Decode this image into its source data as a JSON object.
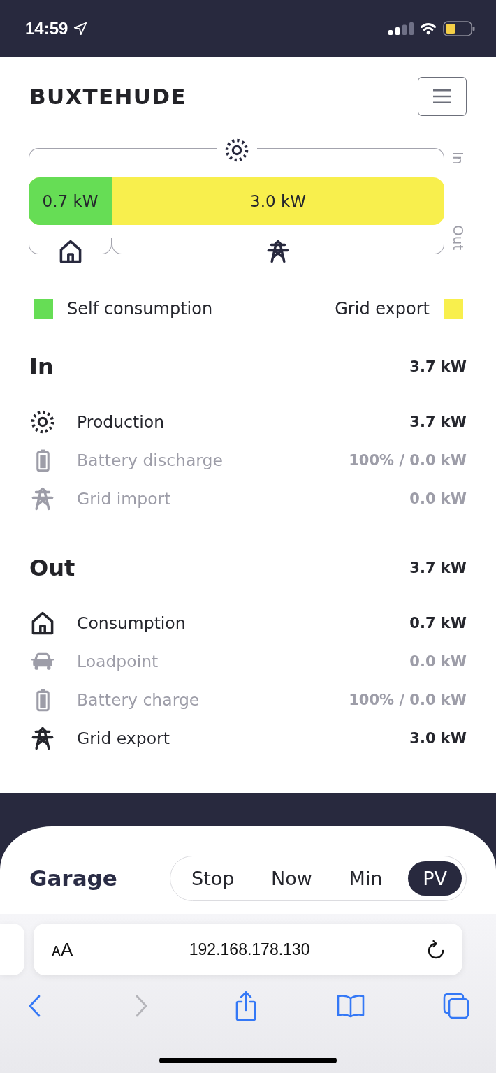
{
  "status_bar": {
    "time": "14:59"
  },
  "header": {
    "title": "BUXTEHUDE"
  },
  "flow": {
    "in_label": "In",
    "out_label": "Out",
    "level": 0.2,
    "segments": [
      {
        "kind": "home",
        "value": "0.7 kW",
        "color": "#66dd55"
      },
      {
        "kind": "grid",
        "value": "3.0 kW",
        "color": "#f8ef4d"
      }
    ]
  },
  "legend": [
    {
      "label": "Self consumption",
      "color": "#66dd55"
    },
    {
      "label": "Grid export",
      "color": "#f8ef4d"
    }
  ],
  "sections": [
    {
      "title": "In",
      "total": "3.7 kW",
      "rows": [
        {
          "kind": "pv",
          "label": "Production",
          "value": "3.7 kW",
          "active": true
        },
        {
          "kind": "battery",
          "label": "Battery discharge",
          "value": "100% / 0.0 kW",
          "active": false
        },
        {
          "kind": "grid",
          "label": "Grid import",
          "value": "0.0 kW",
          "active": false
        }
      ]
    },
    {
      "title": "Out",
      "total": "3.7 kW",
      "rows": [
        {
          "kind": "home",
          "label": "Consumption",
          "value": "0.7 kW",
          "active": true
        },
        {
          "kind": "vehicle",
          "label": "Loadpoint",
          "value": "0.0 kW",
          "active": false
        },
        {
          "kind": "battery",
          "label": "Battery charge",
          "value": "100% / 0.0 kW",
          "active": false
        },
        {
          "kind": "grid",
          "label": "Grid export",
          "value": "3.0 kW",
          "active": true
        }
      ]
    }
  ],
  "loadpoint": {
    "title": "Garage",
    "modes": [
      {
        "label": "Stop",
        "selected": false
      },
      {
        "label": "Now",
        "selected": false
      },
      {
        "label": "Min",
        "selected": false
      },
      {
        "label": "PV",
        "selected": true
      }
    ]
  },
  "browser": {
    "text_size_label": "ᴀA",
    "url": "192.168.178.130",
    "toolbar": [
      {
        "kind": "back",
        "disabled": false
      },
      {
        "kind": "forward",
        "disabled": true
      },
      {
        "kind": "share",
        "disabled": false
      },
      {
        "kind": "bookmarks",
        "disabled": false
      },
      {
        "kind": "tabs",
        "disabled": false
      }
    ]
  }
}
